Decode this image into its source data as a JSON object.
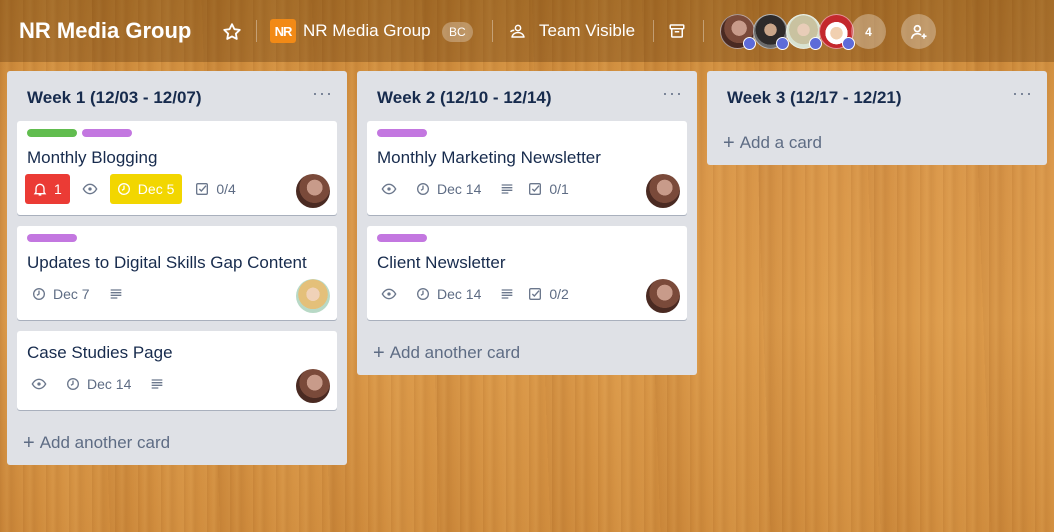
{
  "header": {
    "board_title": "NR Media Group",
    "team_logo_text": "NR",
    "team_name": "NR Media Group",
    "team_badge": "BC",
    "visibility": "Team Visible",
    "member_count": "4",
    "icons": [
      "star-icon",
      "team-visible-icon",
      "archive-icon",
      "add-member-icon"
    ]
  },
  "lists": [
    {
      "title": "Week 1 (12/03 - 12/07)",
      "cards": [
        {
          "labels": [
            "#61bd4f",
            "#c377e0"
          ],
          "title": "Monthly Blogging",
          "notifications": "1",
          "due": "Dec 5",
          "checklist": "0/4"
        },
        {
          "labels": [
            "#c377e0"
          ],
          "title": "Updates to Digital Skills Gap Content",
          "due": "Dec 7"
        },
        {
          "labels": [],
          "title": "Case Studies Page",
          "due": "Dec 14"
        }
      ],
      "add_label": "Add another card"
    },
    {
      "title": "Week 2 (12/10 - 12/14)",
      "cards": [
        {
          "labels": [
            "#c377e0"
          ],
          "title": "Monthly Marketing Newsletter",
          "due": "Dec 14",
          "checklist": "0/1"
        },
        {
          "labels": [
            "#c377e0"
          ],
          "title": "Client Newsletter",
          "due": "Dec 14",
          "checklist": "0/2"
        }
      ],
      "add_label": "Add another card"
    },
    {
      "title": "Week 3 (12/17 - 12/21)",
      "cards": [],
      "add_label": "Add a card"
    }
  ],
  "colors": {
    "alert": "#eb3b35",
    "due_soon": "#f2d600",
    "label_green": "#61bd4f",
    "label_purple": "#c377e0"
  }
}
